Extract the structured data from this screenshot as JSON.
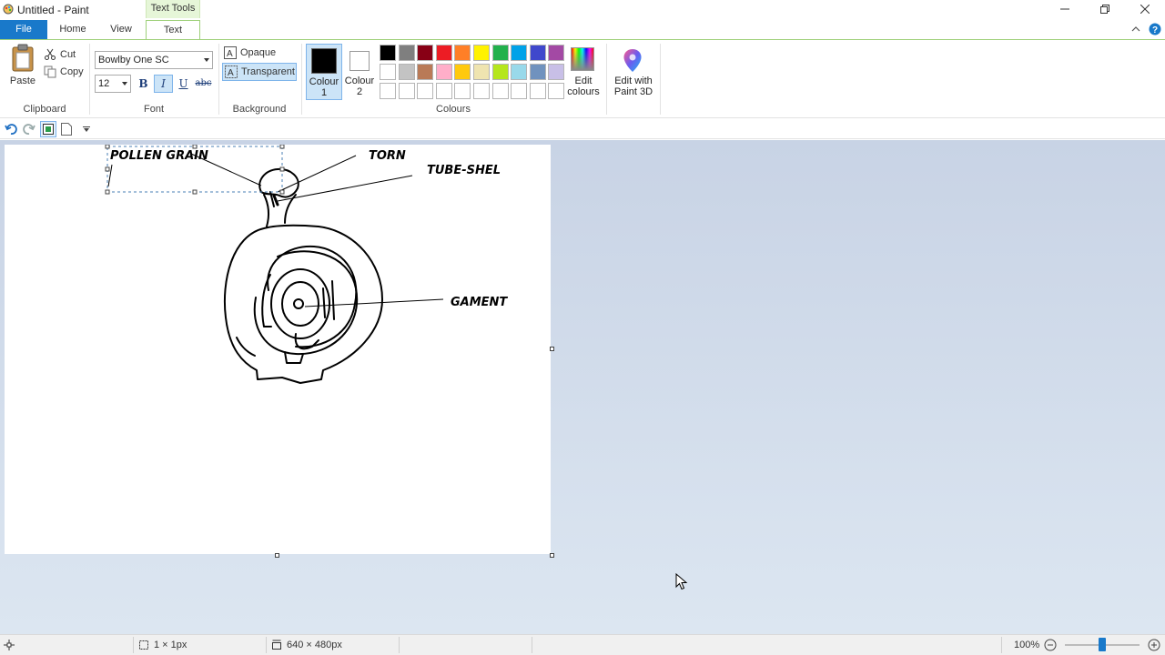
{
  "window": {
    "title": "Untitled - Paint",
    "context_tab": "Text Tools"
  },
  "tabs": [
    {
      "label": "File"
    },
    {
      "label": "Home"
    },
    {
      "label": "View"
    },
    {
      "label": "Text"
    }
  ],
  "clipboard": {
    "paste": "Paste",
    "cut": "Cut",
    "copy": "Copy",
    "label": "Clipboard"
  },
  "font": {
    "family": "Bowlby One SC",
    "size": "12",
    "bold": "B",
    "italic": "I",
    "underline": "U",
    "strike": "abc",
    "label": "Font"
  },
  "background": {
    "opaque": "Opaque",
    "transparent": "Transparent",
    "label": "Background"
  },
  "colours": {
    "colour1_line1": "Colour",
    "colour1_line2": "1",
    "colour2_line1": "Colour",
    "colour2_line2": "2",
    "edit_line1": "Edit",
    "edit_line2": "colours",
    "paint3d_line1": "Edit with",
    "paint3d_line2": "Paint 3D",
    "label": "Colours",
    "colour1_value": "#000000",
    "colour2_value": "#ffffff",
    "palette_row1": [
      "#000000",
      "#7f7f7f",
      "#880015",
      "#ed1c24",
      "#ff7f27",
      "#fff200",
      "#22b14c",
      "#00a2e8",
      "#3f48cc",
      "#a349a4"
    ],
    "palette_row2": [
      "#ffffff",
      "#c3c3c3",
      "#b97a57",
      "#ffaec9",
      "#ffc90e",
      "#efe4b0",
      "#b5e61d",
      "#99d9ea",
      "#7092be",
      "#c8bfe7"
    ],
    "palette_row3": [
      "#ffffff",
      "#ffffff",
      "#ffffff",
      "#ffffff",
      "#ffffff",
      "#ffffff",
      "#ffffff",
      "#ffffff",
      "#ffffff",
      "#ffffff"
    ]
  },
  "drawing": {
    "label_pollen": "POLLEN GRAIN",
    "label_torn": "TORN",
    "label_tube": "TUBE-SHEL",
    "label_gament": "GAMENT"
  },
  "status": {
    "selection_size": "1 × 1px",
    "canvas_size": "640 × 480px",
    "zoom": "100%",
    "zoom_level": 0.5
  }
}
